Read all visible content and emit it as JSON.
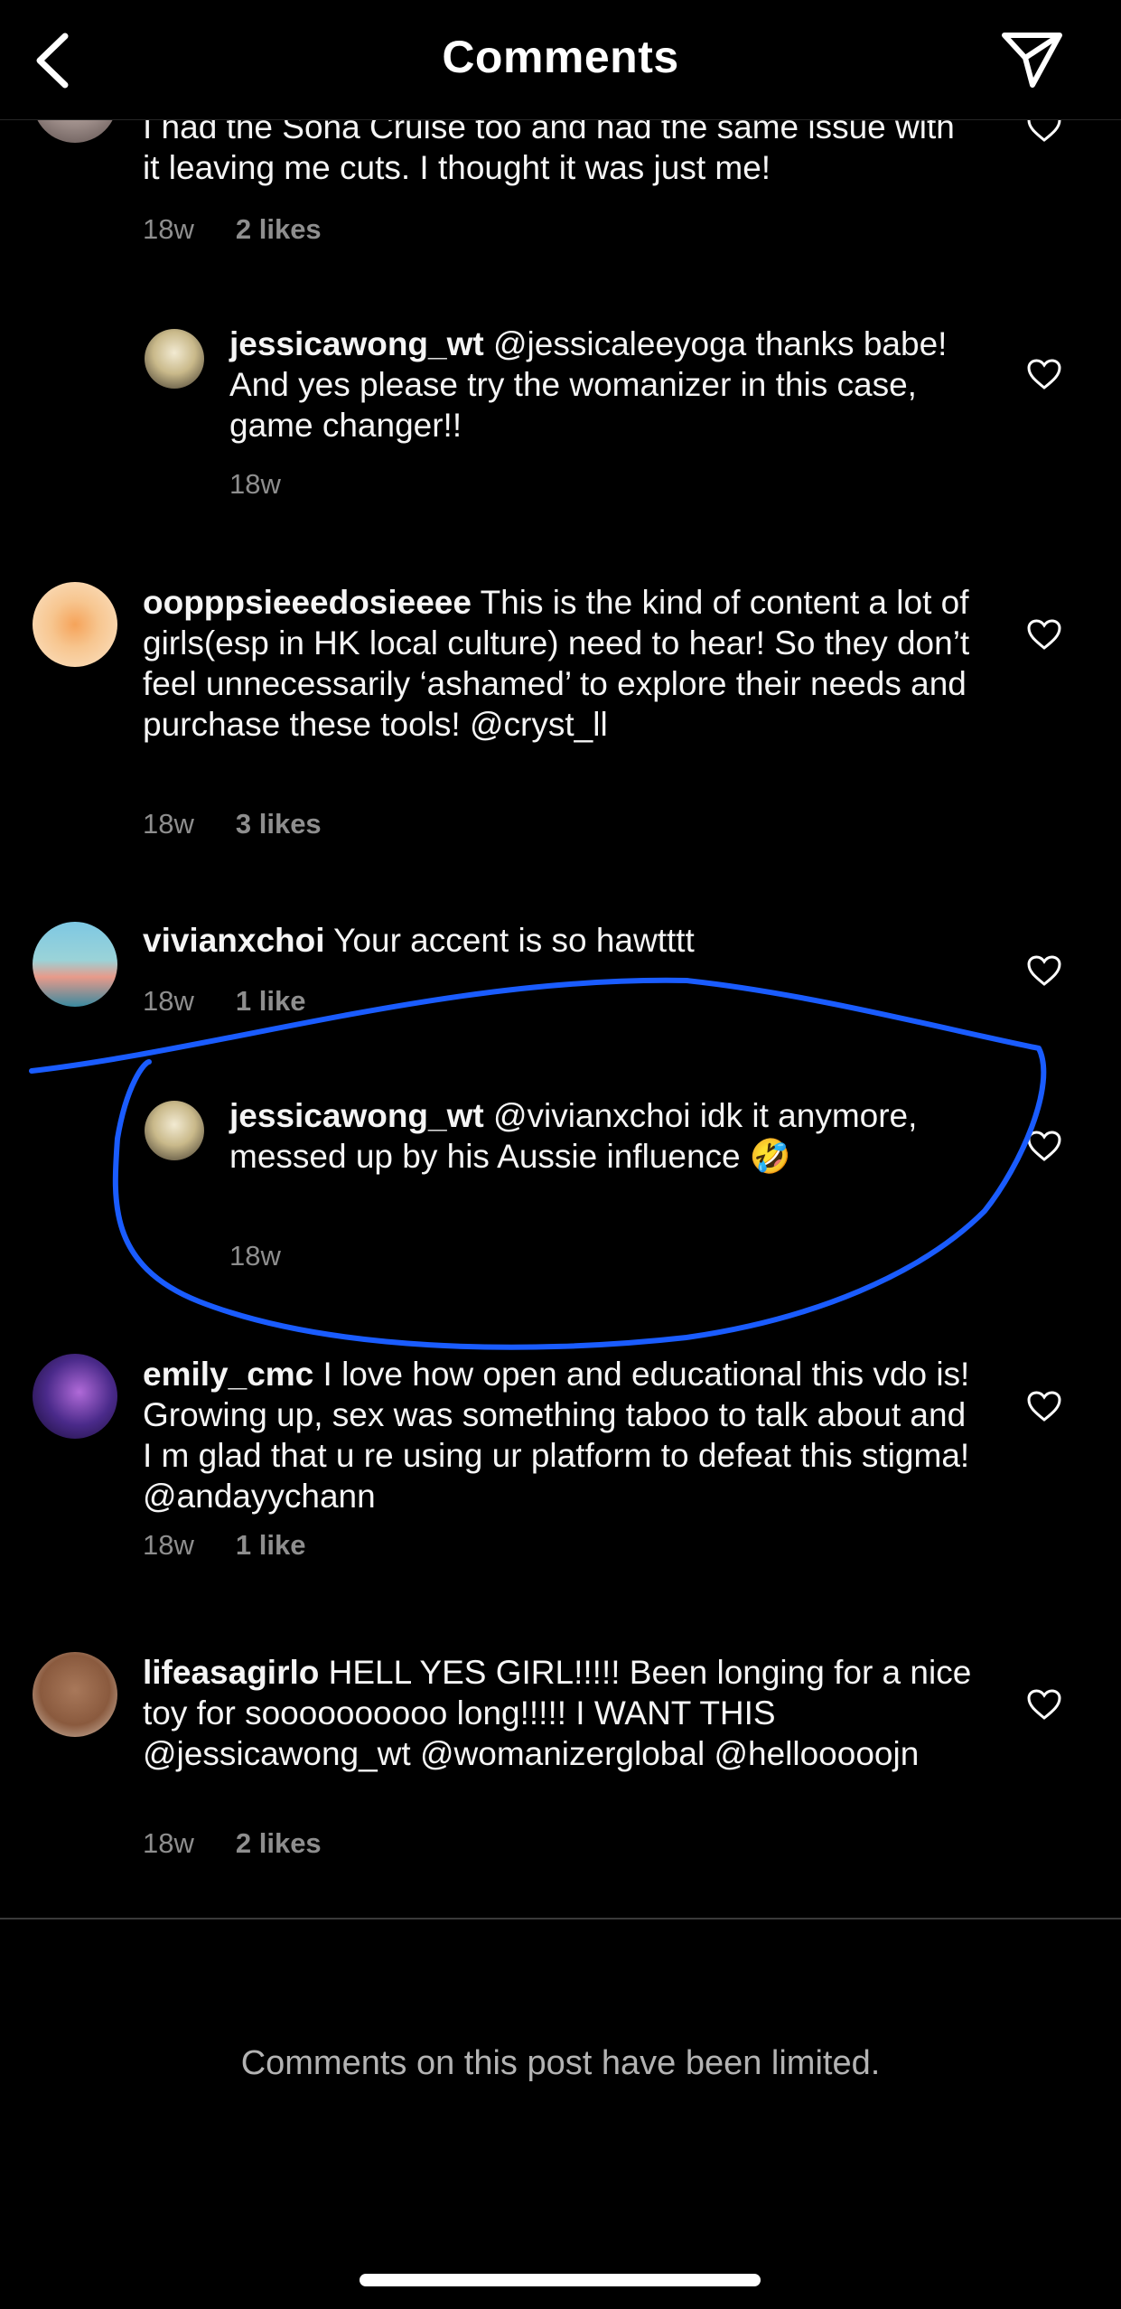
{
  "header": {
    "title": "Comments"
  },
  "comments": [
    {
      "id": "c0",
      "type": "main",
      "user": "",
      "text": "I had the Sona Cruise too and had the same issue with it leaving me cuts. I thought it was just me!",
      "time": "18w",
      "likes": "2 likes"
    },
    {
      "id": "c1",
      "type": "reply",
      "user": "jessicawong_wt",
      "mention": "@jessicaleeyoga",
      "text": " thanks babe! And yes please try the womanizer in this case, game changer!!",
      "time": "18w",
      "likes": ""
    },
    {
      "id": "c2",
      "type": "main",
      "user": "oopppsieeedosieeee",
      "text": " This is the kind of content a lot of girls(esp in HK local culture) need to hear! So they don’t feel unnecessarily ‘ashamed’ to explore their needs and purchase these tools! @cryst_ll",
      "time": "18w",
      "likes": "3 likes"
    },
    {
      "id": "c3",
      "type": "main",
      "user": "vivianxchoi",
      "text": " Your accent is so hawtttt",
      "time": "18w",
      "likes": "1 like"
    },
    {
      "id": "c4",
      "type": "reply",
      "user": "jessicawong_wt",
      "mention": "@vivianxchoi",
      "text": " idk it anymore, messed up by his Aussie influence 🤣",
      "time": "18w",
      "likes": ""
    },
    {
      "id": "c5",
      "type": "main",
      "user": "emily_cmc",
      "text": " I love how open and educational this vdo is! Growing up, sex was something taboo to talk about and I m glad that u re using ur platform to defeat this stigma! @andayychann",
      "time": "18w",
      "likes": "1 like"
    },
    {
      "id": "c6",
      "type": "main",
      "user": "lifeasagirlo",
      "text": " HELL YES GIRL!!!!! Been longing for a nice toy for soooooooooo long!!!!! I WANT THIS @jessicawong_wt @womanizerglobal @hellooooojn",
      "time": "18w",
      "likes": "2 likes"
    }
  ],
  "footer": {
    "limited_notice": "Comments on this post have been limited."
  },
  "colors": {
    "background": "#000000",
    "secondary_text": "#8e8e8e",
    "annotation": "#1a5cff"
  },
  "icons": {
    "back": "chevron-left-icon",
    "send": "paper-plane-icon",
    "like": "heart-outline-icon"
  }
}
